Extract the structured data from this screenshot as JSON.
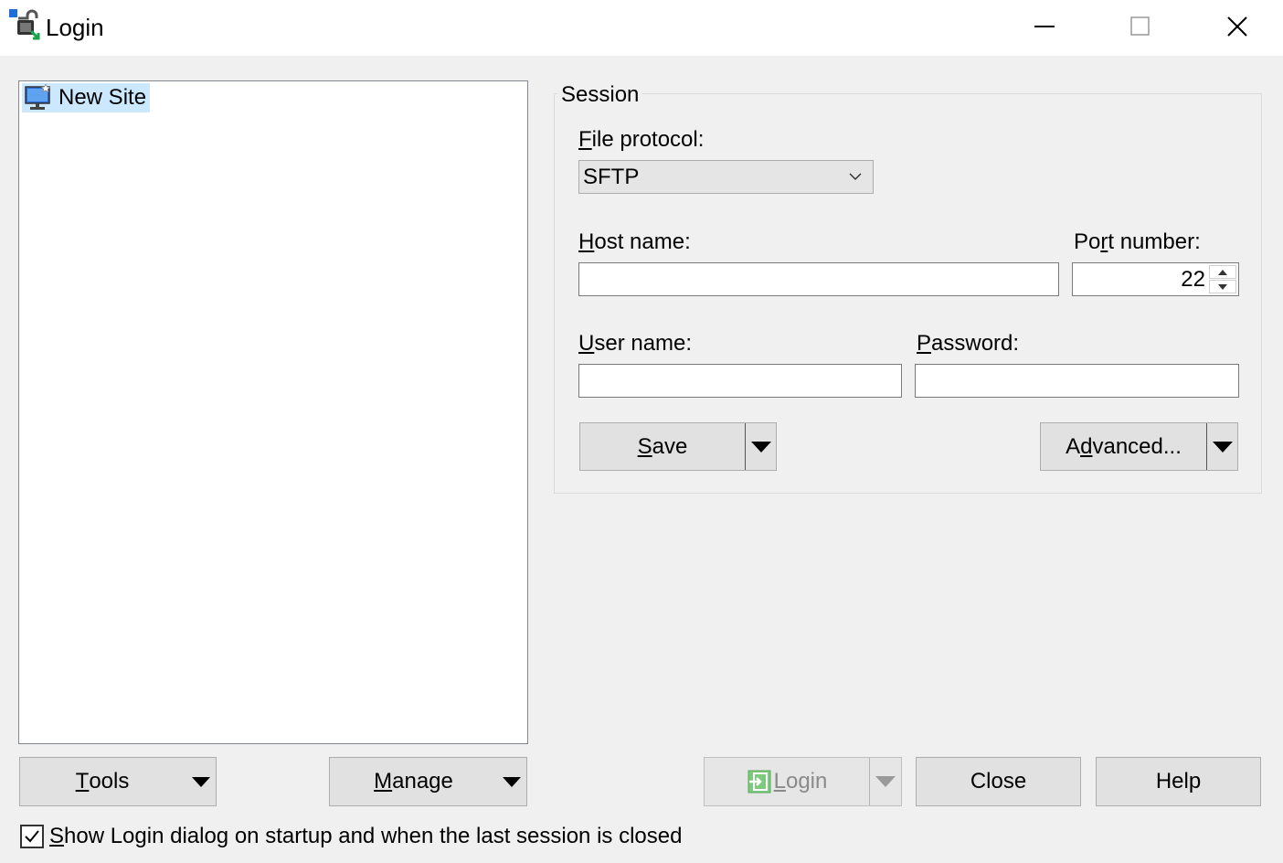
{
  "window": {
    "title": "Login",
    "icon": "winscp-lock-icon",
    "controls": [
      "minimize-icon",
      "maximize-icon",
      "close-icon"
    ]
  },
  "sites": {
    "items": [
      {
        "label": "New Site",
        "icon": "new-site-monitor-icon",
        "selected": true
      }
    ]
  },
  "session": {
    "group_title": "Session",
    "file_protocol": {
      "label_first": "F",
      "label_rest": "ile protocol:",
      "value": "SFTP"
    },
    "host_name": {
      "label_first": "H",
      "label_rest": "ost name:",
      "value": ""
    },
    "port_number": {
      "label_pre": "Po",
      "label_first": "r",
      "label_rest": "t number:",
      "value": "22"
    },
    "user_name": {
      "label_first": "U",
      "label_rest": "ser name:",
      "value": ""
    },
    "password": {
      "label_first": "P",
      "label_rest": "assword:",
      "value": ""
    },
    "save": {
      "label_first": "S",
      "label_rest": "ave"
    },
    "advanced": {
      "label_pre": "A",
      "label_first": "d",
      "label_rest": "vanced..."
    }
  },
  "bottom": {
    "tools": {
      "label_first": "T",
      "label_rest": "ools"
    },
    "manage": {
      "label_first": "M",
      "label_rest": "anage"
    },
    "login": {
      "label_first": "L",
      "label_rest": "ogin",
      "enabled": false
    },
    "close": {
      "label": "Close"
    },
    "help": {
      "label": "Help"
    },
    "show_login": {
      "checked": true,
      "label_first": "S",
      "label_rest": "how Login dialog on startup and when the last session is closed"
    }
  },
  "colors": {
    "selection": "#cce8ff",
    "button_face": "#e1e1e1",
    "window_bg": "#f0f0f0",
    "login_icon_green": "#7dc97d"
  }
}
